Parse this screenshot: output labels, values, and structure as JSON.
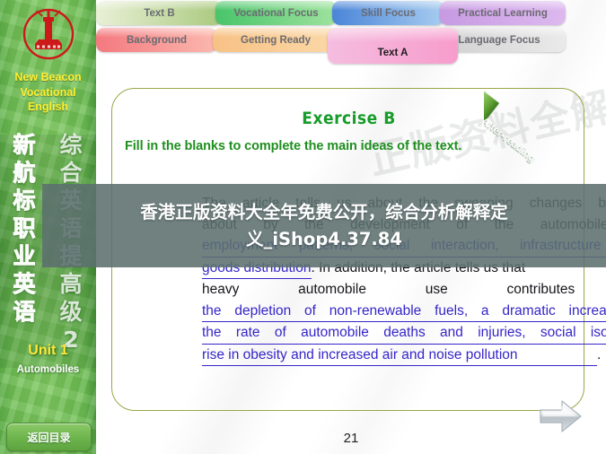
{
  "sidebar": {
    "logo_icon": "beacon-lighthouse-icon",
    "brand_lines": [
      "New Beacon",
      "Vocational",
      "English"
    ],
    "cn_col_left": [
      "新",
      "航",
      "标",
      "职",
      "业",
      "英",
      "语"
    ],
    "cn_col_right": [
      "综",
      "合",
      "英",
      "语",
      "提",
      "高",
      "级",
      "2"
    ],
    "unit_label": "Unit 1",
    "unit_topic": "Automobiles",
    "back_button": "返回目录"
  },
  "tabs": {
    "row1": [
      {
        "label": "Text B",
        "color_from": "#e9f0d6",
        "color_to": "#a9c97e"
      },
      {
        "label": "Vocational Focus",
        "color_from": "#49c46a",
        "color_to": "#9fe39e"
      },
      {
        "label": "Skill Focus",
        "color_from": "#4a85d8",
        "color_to": "#a8cdf0"
      },
      {
        "label": "Practical Learning",
        "color_from": "#c79ae2",
        "color_to": "#ddb9ef"
      }
    ],
    "row2": [
      {
        "label": "Background",
        "color_from": "#f4797f",
        "color_to": "#fbb8ae"
      },
      {
        "label": "Getting Ready",
        "color_from": "#f7c185",
        "color_to": "#fbd9a8"
      },
      {
        "label": "Language Focus",
        "color_from": "#cfcfcf",
        "color_to": "#eaeaea"
      }
    ],
    "active": {
      "label": "Text A",
      "color_from": "#f5bde0",
      "color_to": "#f79ccc"
    }
  },
  "card": {
    "ribbon_label": "After-reading",
    "exercise_title": "Exercise B",
    "exercise_instruction": "Fill in the blanks to complete the main ideas of the text."
  },
  "paragraph": {
    "line1": "The article tells us about the sweeping changes brought",
    "line2": "about by the development of the automobile in",
    "line3_answer": "employment patterns, social interaction, infrastructure and",
    "line4_answer": "goods distribution",
    "line4_rest": ". In addition, the article tells us that",
    "line5": "heavy automobile use contributes to",
    "line6_answer": "the depletion of non-renewable fuels, a dramatic increase in",
    "line7_answer": "the rate of automobile deaths and injuries, social isolation,",
    "line8_answer": "rise in obesity and increased air and noise pollution",
    "line8_rest": ".",
    "answer_color": "#3526c8"
  },
  "footer": {
    "page_number": "21",
    "next_arrow_icon": "next-arrow-icon"
  },
  "watermark": {
    "text": "正版资料全解析"
  },
  "overlay": {
    "line1": "香港正版资料大全年免费公开，综合分析解释定",
    "line2": "义_iShop4.37.84"
  }
}
